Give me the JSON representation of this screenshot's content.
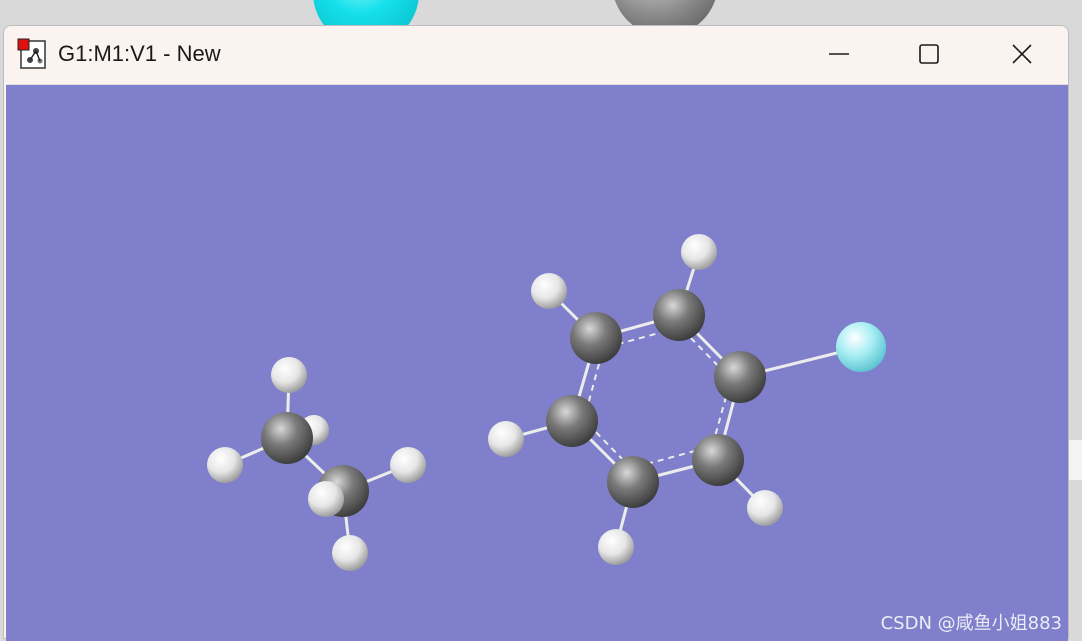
{
  "window": {
    "title": "G1:M1:V1 - New",
    "controls": {
      "minimize_icon": "minimize-icon",
      "maximize_icon": "maximize-icon",
      "close_icon": "close-icon"
    }
  },
  "viewport": {
    "background_color": "#7f7fcb",
    "atom_colors": {
      "carbon": "#6e6e6e",
      "hydrogen": "#f2f2f2",
      "fluorine": "#9ae8f0"
    }
  },
  "watermark": "CSDN @咸鱼小姐883"
}
